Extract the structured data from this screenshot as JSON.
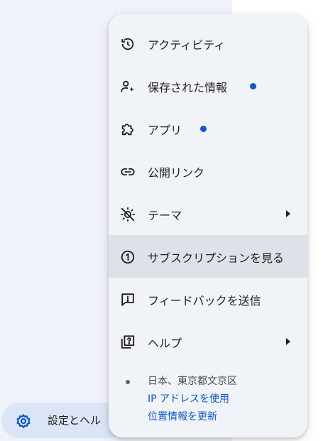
{
  "sidebar": {
    "settings_label": "設定とヘル"
  },
  "menu": {
    "items": [
      {
        "label": "アクティビティ",
        "icon": "history-icon"
      },
      {
        "label": "保存された情報",
        "icon": "person-sparkle-icon",
        "badge": true
      },
      {
        "label": "アプリ",
        "icon": "puzzle-icon",
        "badge": true
      },
      {
        "label": "公開リンク",
        "icon": "link-icon"
      },
      {
        "label": "テーマ",
        "icon": "theme-icon",
        "submenu": true
      },
      {
        "label": "サブスクリプションを見る",
        "icon": "subscription-icon",
        "highlighted": true
      },
      {
        "label": "フィードバックを送信",
        "icon": "feedback-icon"
      },
      {
        "label": "ヘルプ",
        "icon": "help-icon",
        "submenu": true
      }
    ]
  },
  "location": {
    "place": "日本、東京都文京区",
    "ip_link": "IP アドレスを使用",
    "update_link": "位置情報を更新"
  },
  "colors": {
    "accent": "#0b57d0",
    "menu_bg": "#f0f4f9",
    "highlight_bg": "#dde2e9",
    "sidebar_bg": "#eff2f8",
    "pill_bg": "#dbe5f6"
  }
}
